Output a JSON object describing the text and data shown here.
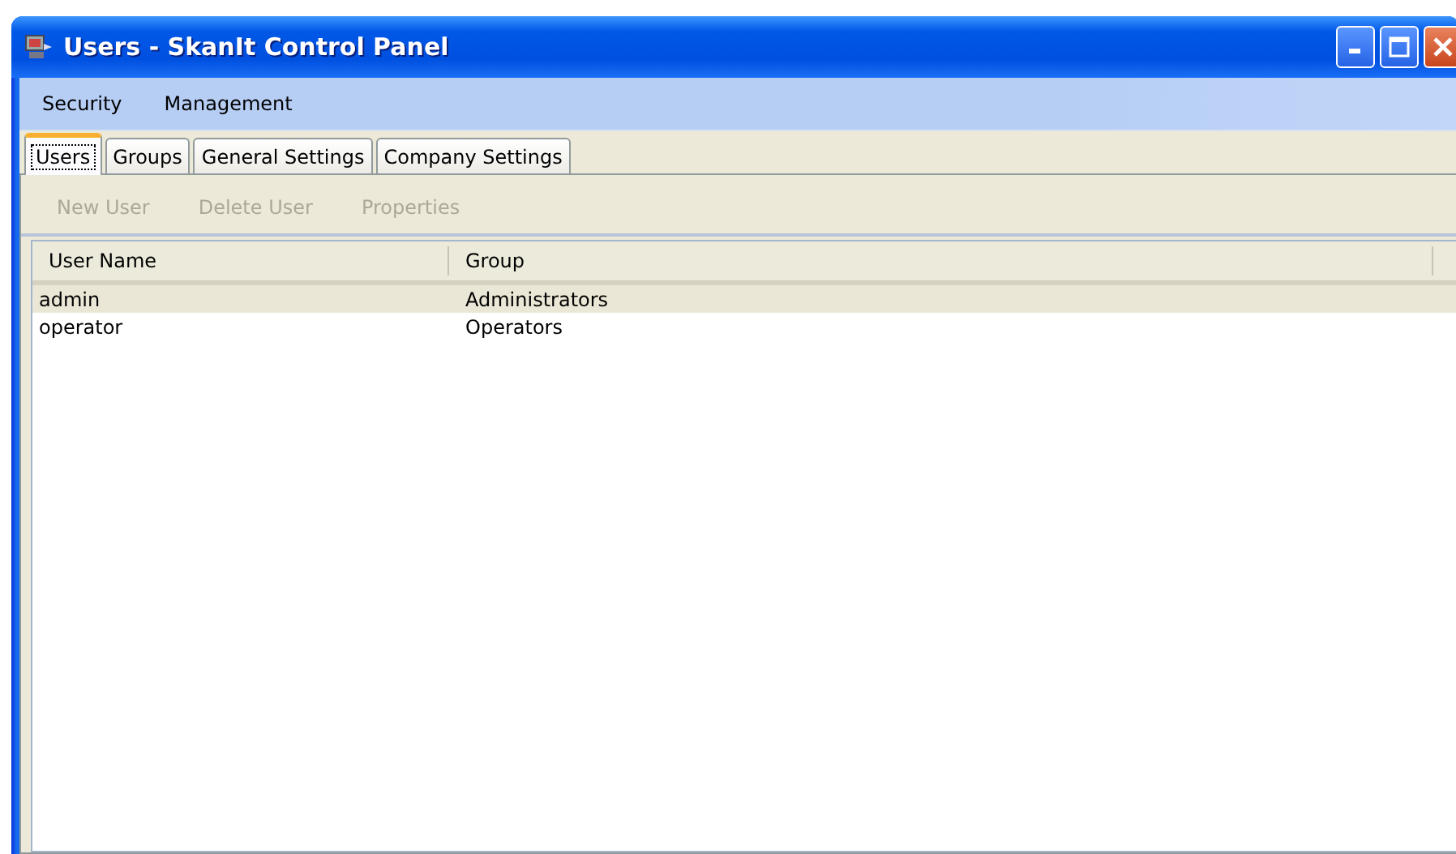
{
  "window": {
    "title": "Users - SkanIt Control Panel"
  },
  "menu": [
    "Security",
    "Management"
  ],
  "tabs": [
    {
      "label": "Users",
      "selected": true
    },
    {
      "label": "Groups",
      "selected": false
    },
    {
      "label": "General Settings",
      "selected": false
    },
    {
      "label": "Company Settings",
      "selected": false
    }
  ],
  "toolbar": [
    {
      "label": "New User",
      "disabled": true
    },
    {
      "label": "Delete User",
      "disabled": true
    },
    {
      "label": "Properties",
      "disabled": true
    }
  ],
  "table": {
    "columns": [
      "User Name",
      "Group"
    ],
    "rows": [
      {
        "cells": [
          "admin",
          "Administrators"
        ],
        "selected": true
      },
      {
        "cells": [
          "operator",
          "Operators"
        ],
        "selected": false
      }
    ]
  }
}
